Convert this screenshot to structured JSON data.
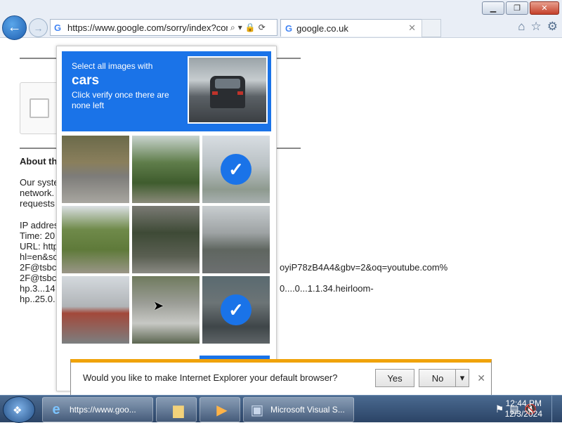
{
  "browser": {
    "address_url": "https://www.google.com/sorry/index?cont",
    "tab_title": "google.co.uk",
    "window_controls": [
      "minimize",
      "restore",
      "close"
    ]
  },
  "page": {
    "about_heading": "About th",
    "para1": [
      "Our syste",
      "network.",
      "requests"
    ],
    "para2": [
      "IP addres",
      "Time: 20",
      "URL: http",
      "hl=en&sc",
      "2F@tsbc",
      "2F@tsbc",
      "hp.3...14",
      "hp..25.0."
    ],
    "url_tail_1": "oyiP78zB4A4&gbv=2&oq=youtube.com%",
    "url_tail_2": "0....0...1.1.34.heirloom-"
  },
  "captcha": {
    "line1": "Select all images with",
    "keyword": "cars",
    "line3": "Click verify once there are none left",
    "tiles": [
      {
        "name": "roadside-guardrail",
        "selected": false
      },
      {
        "name": "trees-street",
        "selected": false
      },
      {
        "name": "bus-stop",
        "selected": true
      },
      {
        "name": "roadside-grass",
        "selected": false
      },
      {
        "name": "palm-tree",
        "selected": false
      },
      {
        "name": "highway-cars",
        "selected": false
      },
      {
        "name": "street-intersection",
        "selected": false
      },
      {
        "name": "crosswalk",
        "selected": false
      },
      {
        "name": "road-cars",
        "selected": true
      }
    ]
  },
  "notification": {
    "message": "Would you like to make Internet Explorer your default browser?",
    "yes_label": "Yes",
    "no_label": "No"
  },
  "taskbar": {
    "ie_label": "https://www.goo...",
    "vs_label": "Microsoft Visual S...",
    "time": "12:44 PM",
    "date": "12/3/2024"
  }
}
